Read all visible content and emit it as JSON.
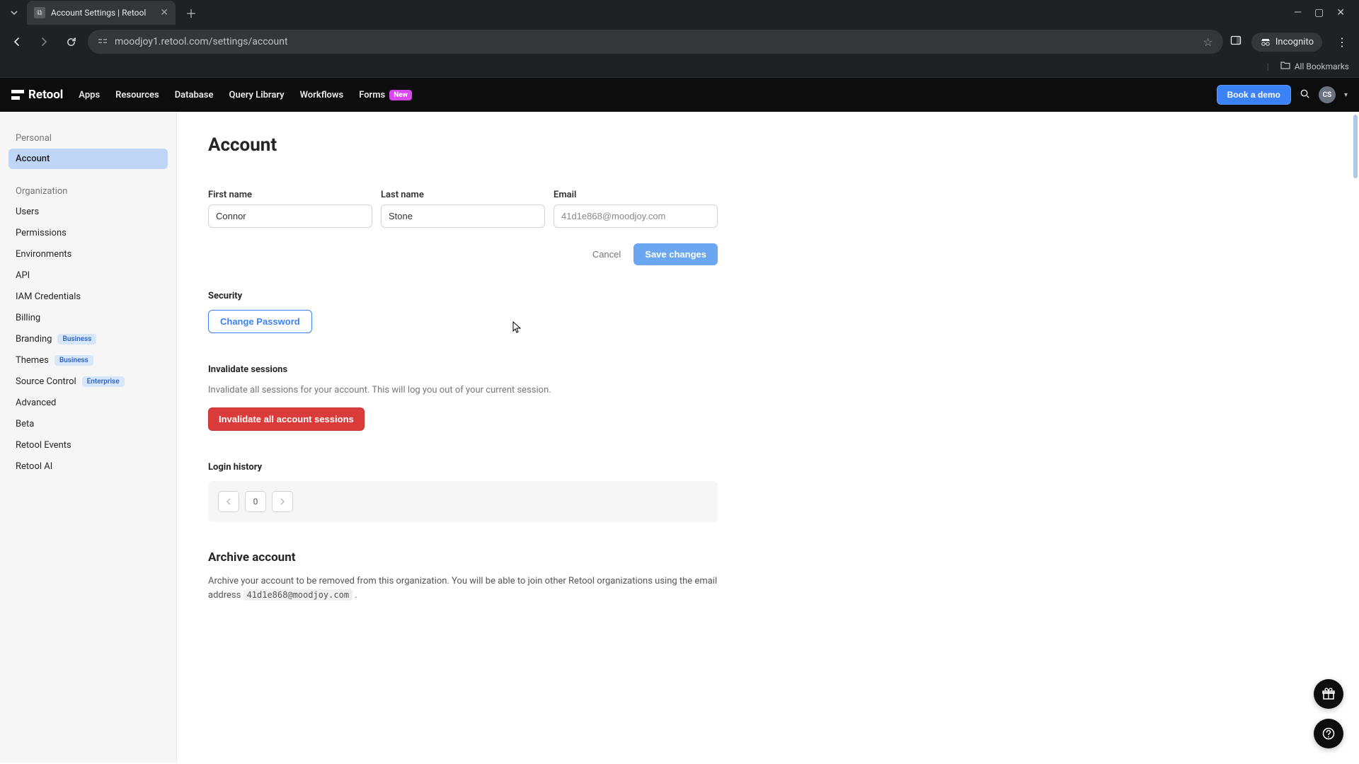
{
  "browser": {
    "tab_title": "Account Settings | Retool",
    "url": "moodjoy1.retool.com/settings/account",
    "incognito_label": "Incognito",
    "all_bookmarks": "All Bookmarks"
  },
  "header": {
    "logo_text": "Retool",
    "nav": {
      "apps": "Apps",
      "resources": "Resources",
      "database": "Database",
      "query_library": "Query Library",
      "workflows": "Workflows",
      "forms": "Forms",
      "forms_badge": "New"
    },
    "book_demo": "Book a demo",
    "avatar_initials": "CS"
  },
  "sidebar": {
    "section_personal": "Personal",
    "section_organization": "Organization",
    "items": {
      "account": "Account",
      "users": "Users",
      "permissions": "Permissions",
      "environments": "Environments",
      "api": "API",
      "iam": "IAM Credentials",
      "billing": "Billing",
      "branding": "Branding",
      "branding_badge": "Business",
      "themes": "Themes",
      "themes_badge": "Business",
      "source_control": "Source Control",
      "source_control_badge": "Enterprise",
      "advanced": "Advanced",
      "beta": "Beta",
      "retool_events": "Retool Events",
      "retool_ai": "Retool AI"
    }
  },
  "page": {
    "title": "Account",
    "labels": {
      "first_name": "First name",
      "last_name": "Last name",
      "email": "Email"
    },
    "values": {
      "first_name": "Connor",
      "last_name": "Stone",
      "email": "41d1e868@moodjoy.com"
    },
    "buttons": {
      "cancel": "Cancel",
      "save": "Save changes",
      "change_password": "Change Password",
      "invalidate": "Invalidate all account sessions"
    },
    "security_heading": "Security",
    "invalidate_heading": "Invalidate sessions",
    "invalidate_desc": "Invalidate all sessions for your account. This will log you out of your current session.",
    "login_history_heading": "Login history",
    "login_history_page": "0",
    "archive_heading": "Archive account",
    "archive_desc_pre": "Archive your account to be removed from this organization. You will be able to join other Retool organizations using the email address ",
    "archive_email": "41d1e868@moodjoy.com",
    "archive_desc_post": " ."
  }
}
